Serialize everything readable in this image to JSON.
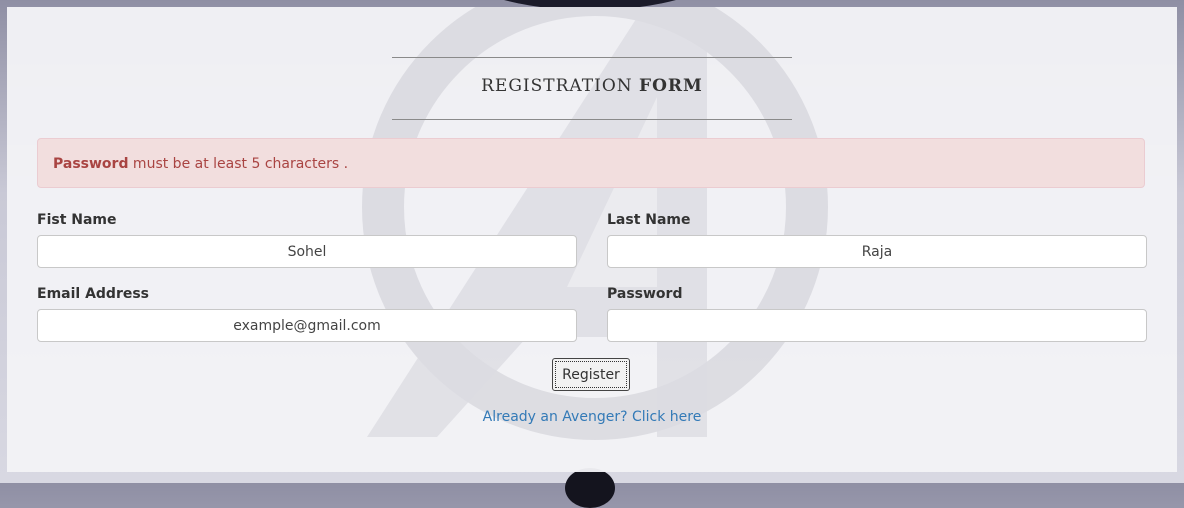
{
  "form": {
    "title_light": "REGISTRATION",
    "title_strong": "FORM",
    "alert": {
      "strong": "Password",
      "message": " must be at least 5 characters ."
    },
    "first_name": {
      "label": "Fist Name",
      "value": "Sohel"
    },
    "last_name": {
      "label": "Last Name",
      "value": "Raja"
    },
    "email": {
      "label": "Email Address",
      "value": "example@gmail.com"
    },
    "password": {
      "label": "Password",
      "value": ""
    },
    "register_label": "Register",
    "login_link": "Already an Avenger? Click here"
  },
  "colors": {
    "alert_bg": "#f2dede",
    "alert_text": "#a94442",
    "link": "#337ab7"
  }
}
